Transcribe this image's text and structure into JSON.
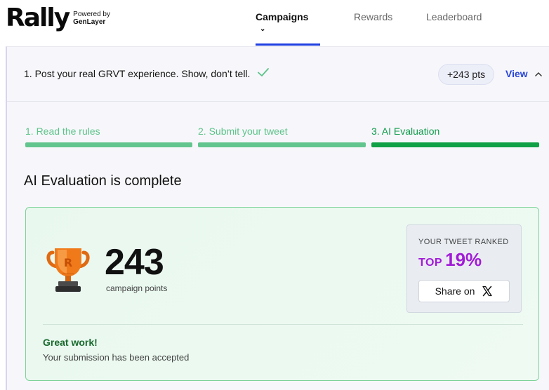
{
  "brand": {
    "name": "Rally",
    "powered_by": "Powered by",
    "powered_by_name": "GenLayer"
  },
  "nav": {
    "items": [
      {
        "label": "Campaigns",
        "active": true
      },
      {
        "label": "Rewards",
        "active": false
      },
      {
        "label": "Leaderboard",
        "active": false
      }
    ]
  },
  "task": {
    "title": "1. Post your real GRVT experience. Show, don’t tell.",
    "points_badge": "+243 pts",
    "view_label": "View"
  },
  "steps": [
    {
      "label": "1. Read the rules"
    },
    {
      "label": "2. Submit your tweet"
    },
    {
      "label": "3. AI Evaluation"
    }
  ],
  "evaluation": {
    "heading": "AI Evaluation is complete",
    "points": "243",
    "points_label": "campaign points",
    "rank_caption": "YOUR TWEET RANKED",
    "rank_top": "TOP",
    "rank_percent": "19%",
    "share_label": "Share on",
    "success_title": "Great work!",
    "success_message": "Your submission has been accepted"
  },
  "colors": {
    "accent_blue": "#2845d8",
    "success_green": "#10a046",
    "rank_purple": "#a11bd6",
    "trophy_orange": "#f07a1a"
  },
  "icons": [
    "check-icon",
    "chevron-down-icon",
    "chevron-up-icon",
    "trophy-icon",
    "x-logo-icon"
  ]
}
